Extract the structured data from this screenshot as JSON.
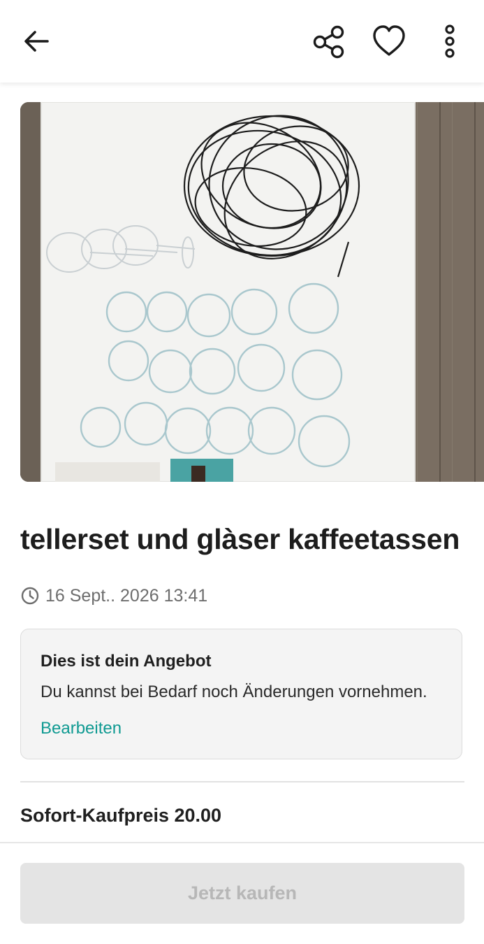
{
  "header": {
    "back_icon": "arrow-left-icon",
    "share_icon": "share-icon",
    "favorite_icon": "heart-outline-icon",
    "menu_icon": "more-vertical-icon"
  },
  "listing": {
    "photo_description_icon": "listing-photo",
    "title": "tellerset und glàser kaffeetassen",
    "date": "16 Sept.. 2026 13:41"
  },
  "offer_notice": {
    "title": "Dies ist dein Angebot",
    "text": "Du kannst bei Bedarf noch Änderungen vornehmen.",
    "edit_label": "Bearbeiten"
  },
  "price": {
    "label": "Sofort-Kaufpreis 20.00"
  },
  "footer": {
    "buy_label": "Jetzt kaufen"
  },
  "colors": {
    "accent": "#0f9a92",
    "disabled_button_bg": "#e4e4e4",
    "disabled_button_text": "#b7b7b7",
    "notice_bg": "#f4f4f4"
  }
}
